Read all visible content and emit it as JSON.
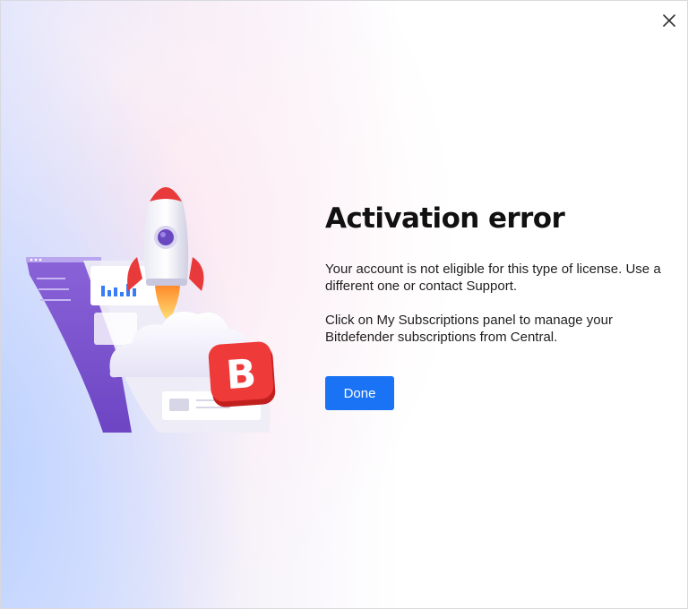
{
  "dialog": {
    "close_icon": "close-icon",
    "title": "Activation error",
    "message_1": "Your account is not eligible for this type of license. Use a different one or contact Support.",
    "message_2": "Click on My Subscriptions panel to manage your Bitdefender subscriptions from Central.",
    "done_label": "Done",
    "accent_color": "#1a73f5"
  },
  "illustration": {
    "icon": "rocket-launch-illustration",
    "badge_letter": "B",
    "badge_color": "#e52b2b"
  }
}
